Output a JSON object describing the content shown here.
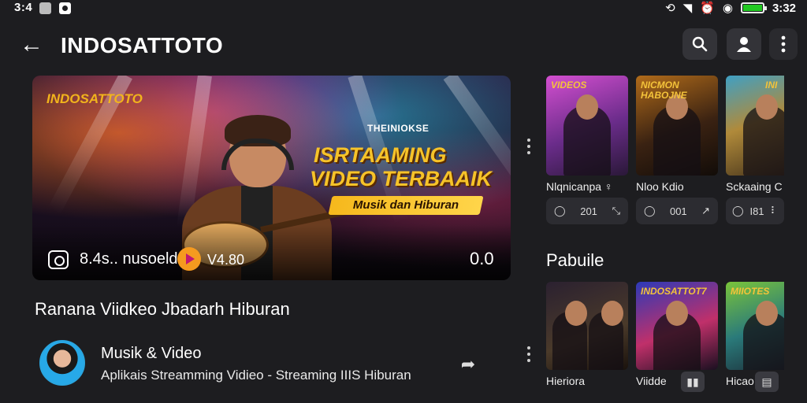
{
  "status_bar": {
    "time_left": "3:4",
    "time_right": "3:32",
    "icons": [
      "gallery-icon",
      "app-icon",
      "rotate-icon",
      "wifi-icon",
      "alarm-icon",
      "sync-icon",
      "battery-icon"
    ],
    "battery_level": 1.0,
    "battery_color": "#22c922"
  },
  "header": {
    "title": "INDOSATTOTO",
    "icons": [
      "back-arrow-icon",
      "search-icon",
      "profile-icon",
      "more-vertical-icon"
    ]
  },
  "hero": {
    "brand": "INDOSATTOTO",
    "tag_small": "THEINIOKSE",
    "headline_1": "ISRTAAMING",
    "headline_2": "VIDEO TERBAAIK",
    "ribbon": "Musik dan Hiburan",
    "views": "8.4s.. nusoeld",
    "version": "V4.80",
    "timer": "0.0"
  },
  "video": {
    "title": "Ranana Viidkeo Jbadarh Hiburan"
  },
  "channel": {
    "name": "Musik & Video",
    "description": "Aplikais Streamming Vidieo - Streaming IIIS Hiburan"
  },
  "top_cards": [
    {
      "name": "Nlqnicanpa ♀",
      "title_text": "VIDEOS",
      "stat_left": "201",
      "stat_right": "⤡"
    },
    {
      "name": "Nloo Kdio",
      "title_text": "NICMON HABOJNE",
      "stat_left": "001",
      "stat_right": "↗"
    },
    {
      "name": "Sckaaing C",
      "title_text": "INI",
      "stat_left": "I81",
      "stat_right": "⠇"
    }
  ],
  "section": {
    "title": "Pabuile"
  },
  "bottom_cards": [
    {
      "name": "Hieriora",
      "title_text": ""
    },
    {
      "name": "Viidde",
      "title_text": "INDOSATTOT7"
    },
    {
      "name": "Hicao",
      "title_text": "MIIOTES"
    }
  ],
  "colors": {
    "background": "#1d1d20",
    "accent_gold": "#f6c329",
    "panel": "#2c2c31"
  }
}
